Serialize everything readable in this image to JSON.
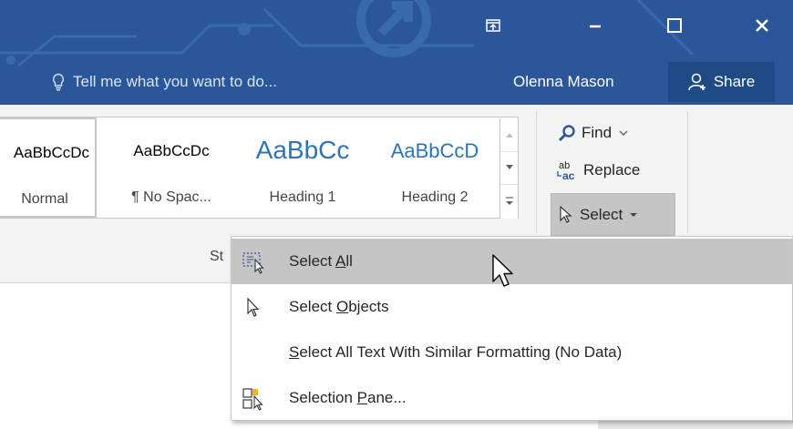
{
  "window_controls": {
    "ribbon_display": "ribbon-display-options-icon",
    "minimize": "minimize-icon",
    "maximize": "maximize-icon",
    "close": "close-icon"
  },
  "tellme": {
    "icon": "lightbulb-icon",
    "placeholder": "Tell me what you want to do..."
  },
  "account": {
    "user_name": "Olenna Mason",
    "share_label": "Share",
    "share_icon": "person-add-icon"
  },
  "styles_gallery": {
    "items": [
      {
        "sample": "AaBbCcDc",
        "name": "Normal"
      },
      {
        "sample": "AaBbCcDc",
        "name": "¶ No Spac..."
      },
      {
        "sample": "AaBbCc",
        "name": "Heading 1"
      },
      {
        "sample": "AaBbCcD",
        "name": "Heading 2"
      }
    ],
    "group_label": "St"
  },
  "editing": {
    "find_label": "Find",
    "replace_label": "Replace",
    "select_label": "Select"
  },
  "select_menu": {
    "items": [
      {
        "pre": "Select ",
        "accel": "A",
        "post": "ll",
        "icon": "select-all-icon",
        "highlighted": true
      },
      {
        "pre": "Select ",
        "accel": "O",
        "post": "bjects",
        "icon": "pointer-icon",
        "highlighted": false
      },
      {
        "pre": "",
        "accel": "S",
        "post": "elect All Text With Similar Formatting (No Data)",
        "icon": "",
        "highlighted": false
      },
      {
        "pre": "Selection ",
        "accel": "P",
        "post": "ane...",
        "icon": "selection-pane-icon",
        "highlighted": false
      }
    ]
  },
  "colors": {
    "titlebar_bg": "#2b579a",
    "share_bg": "#1e4a86",
    "ribbon_bg": "#f3f3f3",
    "highlight": "#c5c5c5",
    "heading_blue": "#2e74b5"
  }
}
